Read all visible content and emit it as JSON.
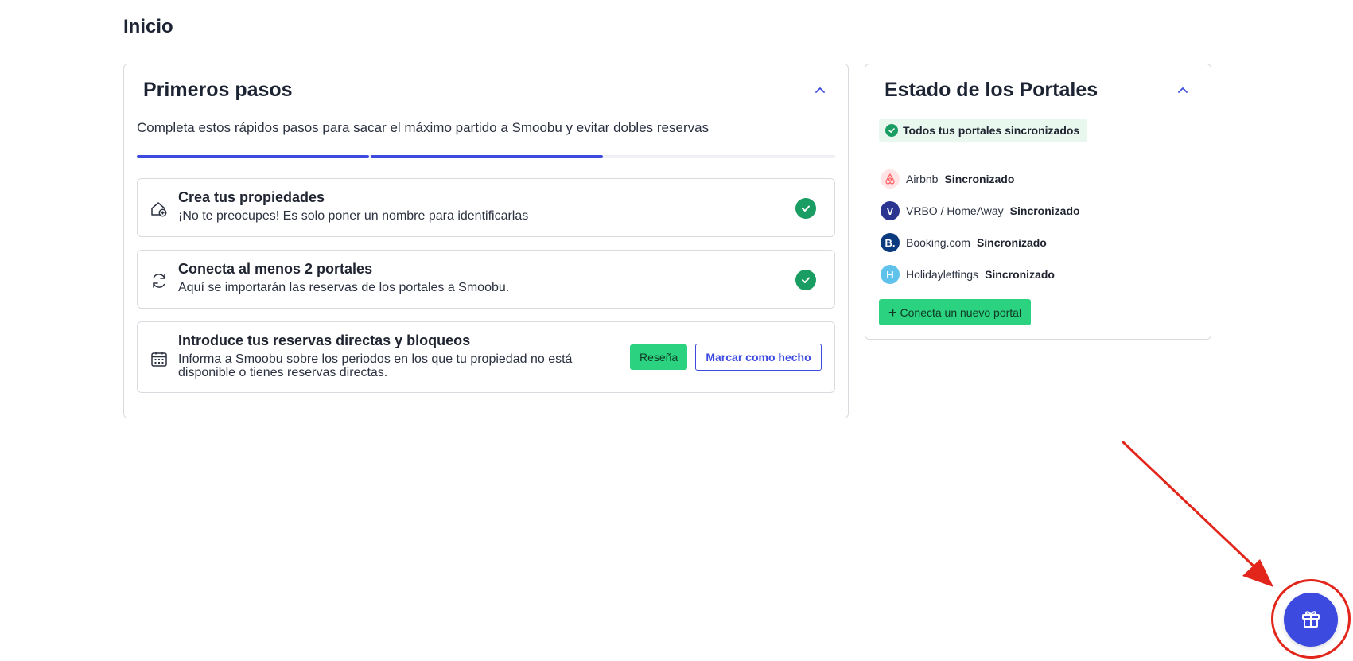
{
  "page": {
    "title": "Inicio"
  },
  "steps_card": {
    "title": "Primeros pasos",
    "description": "Completa estos rápidos pasos para sacar el máximo partido a Smoobu y evitar dobles reservas",
    "progress_completed": 2,
    "progress_total": 3,
    "items": [
      {
        "title": "Crea tus propiedades",
        "description": "¡No te preocupes! Es solo poner un nombre para identificarlas",
        "done": true,
        "icon": "house-add-icon"
      },
      {
        "title": "Conecta al menos 2 portales",
        "description": "Aquí se importarán las reservas de los portales a Smoobu.",
        "done": true,
        "icon": "sync-icon"
      },
      {
        "title": "Introduce tus reservas directas y bloqueos",
        "description": "Informa a Smoobu sobre los periodos en los que tu propiedad no está disponible o tienes reservas directas.",
        "done": false,
        "icon": "calendar-icon",
        "review_label": "Reseña",
        "mark_done_label": "Marcar como hecho"
      }
    ]
  },
  "portals_card": {
    "title": "Estado de los Portales",
    "sync_badge": "Todos tus portales sincronizados",
    "portals": [
      {
        "name": "Airbnb",
        "status": "Sincronizado",
        "logo": "airbnb-logo",
        "logo_letter": ""
      },
      {
        "name": "VRBO / HomeAway",
        "status": "Sincronizado",
        "logo": "vrbo-logo",
        "logo_letter": "V"
      },
      {
        "name": "Booking.com",
        "status": "Sincronizado",
        "logo": "booking-logo",
        "logo_letter": "B."
      },
      {
        "name": "Holidaylettings",
        "status": "Sincronizado",
        "logo": "holidaylettings-logo",
        "logo_letter": "H"
      }
    ],
    "connect_label": "Conecta un nuevo portal"
  },
  "floating": {
    "icon": "gift-icon"
  },
  "colors": {
    "accent": "#3d4adf",
    "success": "#1a9d63",
    "green_button": "#2bd27f",
    "annotation": "#e2261b"
  }
}
